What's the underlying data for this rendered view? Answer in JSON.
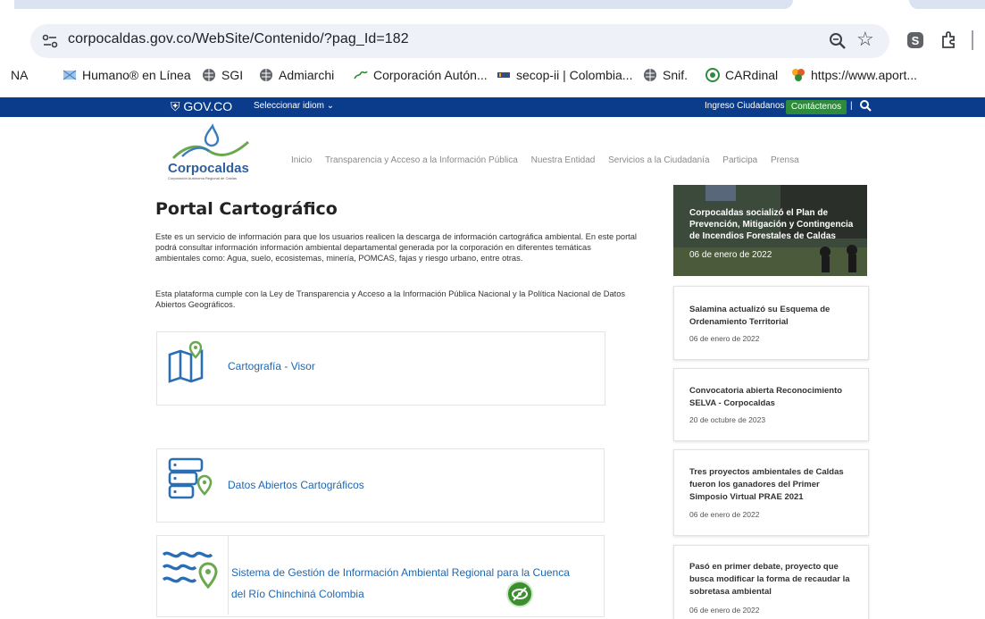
{
  "browser": {
    "url": "corpocaldas.gov.co/WebSite/Contenido/?pag_Id=182",
    "bookmarks": [
      "NA",
      "Humano® en Línea",
      "SGI",
      "Admiarchi",
      "Corporación Autón...",
      "secop-ii | Colombia...",
      "Snif.",
      "CARdinal",
      "https://www.aport..."
    ]
  },
  "govbar": {
    "logo_text": "GOV.CO",
    "language": "Seleccionar idiom",
    "citizen_login": "Ingreso Ciudadanos",
    "separator": "|",
    "contact": "Contáctenos"
  },
  "site": {
    "logo_text": "Corpocaldas",
    "logo_subtext": "Corporación Autónoma Regional de Caldas",
    "nav": [
      "Inicio",
      "Transparencia y Acceso a la Información Pública",
      "Nuestra Entidad",
      "Servicios a la Ciudadanía",
      "Participa",
      "Prensa"
    ]
  },
  "main": {
    "title": "Portal Cartográfico",
    "paragraph1": "Este es un servicio de información para que los usuarios realicen la descarga de información cartográfica ambiental. En este portal podrá consultar información información ambiental departamental generada por la corporación en diferentes temáticas ambientales como: Agua, suelo, ecosistemas, minería, POMCAS, fajas y riesgo urbano, entre otras.",
    "paragraph2": "Esta plataforma cumple con la Ley de Transparencia y Acceso a la Información Pública Nacional y la Política Nacional de Datos Abiertos Geográficos.",
    "cards": [
      {
        "title": "Cartografía - Visor",
        "icon": "map-pin-icon"
      },
      {
        "title": "Datos Abiertos Cartográficos",
        "icon": "server-location-icon"
      },
      {
        "title_line1": "Sistema de Gestión de Información Ambiental Regional para la Cuenca",
        "title_line2": "del Río Chinchiná Colombia",
        "icon": "water-location-icon"
      }
    ]
  },
  "news": {
    "hero": {
      "title": "Corpocaldas socializó el Plan de Prevención, Mitigación y Contingencia de Incendios Forestales de Caldas",
      "date": "06 de enero de 2022"
    },
    "items": [
      {
        "title": "Salamina actualizó su Esquema de Ordenamiento Territorial",
        "date": "06 de enero de 2022"
      },
      {
        "title": "Convocatoria abierta Reconocimiento SELVA - Corpocaldas",
        "date": "20 de octubre de 2023"
      },
      {
        "title": "Tres proyectos ambientales de Caldas fueron los ganadores del Primer Simposio Virtual PRAE 2021",
        "date": "06 de enero de 2022"
      },
      {
        "title": "Pasó en primer debate, proyecto que busca modificar la forma de recaudar la sobretasa ambiental",
        "date": "06 de enero de 2022"
      }
    ]
  },
  "colors": {
    "gov_blue": "#0b3c8c",
    "link_blue": "#1d67b4",
    "green": "#2e8b3c"
  }
}
